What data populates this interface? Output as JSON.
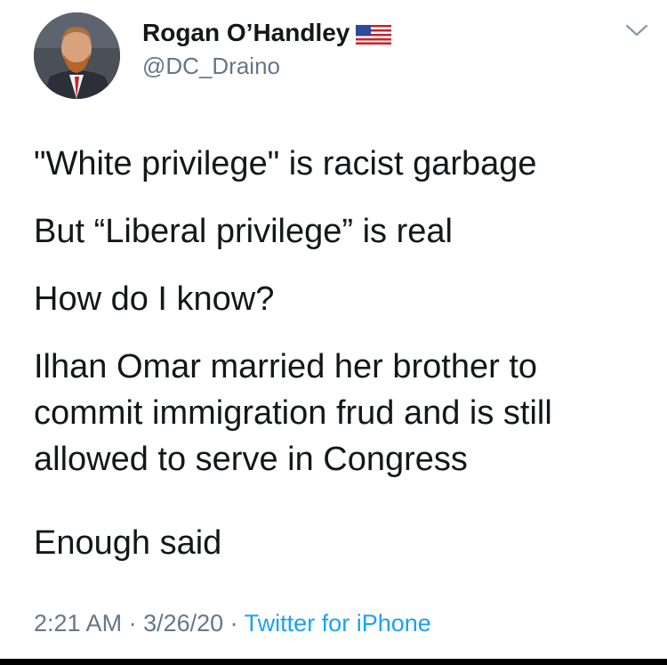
{
  "author": {
    "display_name": "Rogan O’Handley",
    "handle": "@DC_Draino",
    "flag_icon": "us-flag-icon",
    "avatar_icon": "profile-photo"
  },
  "menu": {
    "icon": "chevron-down-icon"
  },
  "tweet": {
    "paragraphs": [
      "\"White privilege\" is racist garbage",
      "But “Liberal privilege” is real",
      "How do I know?",
      "Ilhan Omar married her brother to commit immigration frud and is still allowed to serve in Congress",
      "Enough said"
    ],
    "paragraph4_lines": [
      "Ilhan Omar married her brother to",
      "commit immigration frud and is still",
      "allowed to serve in Congress"
    ]
  },
  "meta": {
    "time": "2:21 AM",
    "separator": " · ",
    "date": "3/26/20",
    "source": "Twitter for iPhone"
  },
  "colors": {
    "text": "#14171a",
    "secondary": "#657786",
    "link": "#1da1f2",
    "background": "#ffffff"
  }
}
